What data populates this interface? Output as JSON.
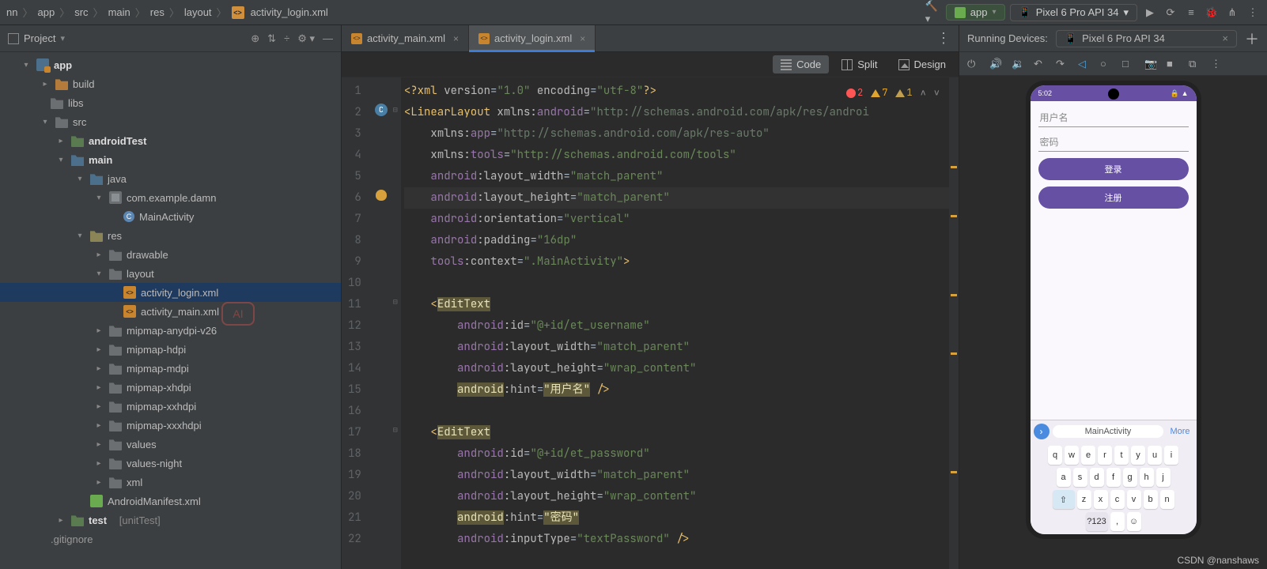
{
  "breadcrumb": {
    "parts": [
      "nn",
      "app",
      "src",
      "main",
      "res",
      "layout"
    ],
    "file": "activity_login.xml"
  },
  "top_run_config": "app",
  "top_device": "Pixel 6 Pro API 34",
  "project_panel_title": "Project",
  "tree": {
    "app": "app",
    "build": "build",
    "libs": "libs",
    "src": "src",
    "androidTest": "androidTest",
    "main": "main",
    "java": "java",
    "pkg": "com.example.damn",
    "activity": "MainActivity",
    "res": "res",
    "drawable": "drawable",
    "layout": "layout",
    "file_login": "activity_login.xml",
    "file_main": "activity_main.xml",
    "mip_any": "mipmap-anydpi-v26",
    "mip_h": "mipmap-hdpi",
    "mip_m": "mipmap-mdpi",
    "mip_xh": "mipmap-xhdpi",
    "mip_xxh": "mipmap-xxhdpi",
    "mip_xxxh": "mipmap-xxxhdpi",
    "values": "values",
    "values_n": "values-night",
    "xml": "xml",
    "manifest": "AndroidManifest.xml",
    "test": "test",
    "test_hint": "[unitTest]",
    "gitignore": ".gitignore"
  },
  "tabs": [
    {
      "label": "activity_main.xml",
      "active": false
    },
    {
      "label": "activity_login.xml",
      "active": true
    }
  ],
  "design_opts": {
    "code": "Code",
    "split": "Split",
    "design": "Design"
  },
  "inspections": {
    "errors": "2",
    "warnings": "7",
    "weak": "1"
  },
  "code_lines": [
    "<?xml version=\"1.0\" encoding=\"utf-8\"?>",
    "<LinearLayout xmlns:android=\"http://schemas.android.com/apk/res/androi",
    "    xmlns:app=\"http://schemas.android.com/apk/res-auto\"",
    "    xmlns:tools=\"http://schemas.android.com/tools\"",
    "    android:layout_width=\"match_parent\"",
    "    android:layout_height=\"match_parent\"",
    "    android:orientation=\"vertical\"",
    "    android:padding=\"16dp\"",
    "    tools:context=\".MainActivity\">",
    "",
    "    <EditText",
    "        android:id=\"@+id/et_username\"",
    "        android:layout_width=\"match_parent\"",
    "        android:layout_height=\"wrap_content\"",
    "        android:hint=\"用户名\" />",
    "",
    "    <EditText",
    "        android:id=\"@+id/et_password\"",
    "        android:layout_width=\"match_parent\"",
    "        android:layout_height=\"wrap_content\"",
    "        android:hint=\"密码\"",
    "        android:inputType=\"textPassword\" />"
  ],
  "running_devices_label": "Running Devices:",
  "running_device_chip": "Pixel 6 Pro API 34",
  "phone": {
    "time": "5:02",
    "hint_user": "用户名",
    "hint_pass": "密码",
    "btn_login": "登录",
    "btn_register": "注册",
    "suggest": "MainActivity",
    "more": "More"
  },
  "keyboard_rows": [
    [
      "q",
      "w",
      "e",
      "r",
      "t",
      "y",
      "u",
      "i"
    ],
    [
      "a",
      "s",
      "d",
      "f",
      "g",
      "h",
      "j"
    ],
    [
      "⇧",
      "z",
      "x",
      "c",
      "v",
      "b",
      "n"
    ],
    [
      "?123",
      ",",
      "☺"
    ]
  ],
  "watermark": "CSDN @nanshaws"
}
